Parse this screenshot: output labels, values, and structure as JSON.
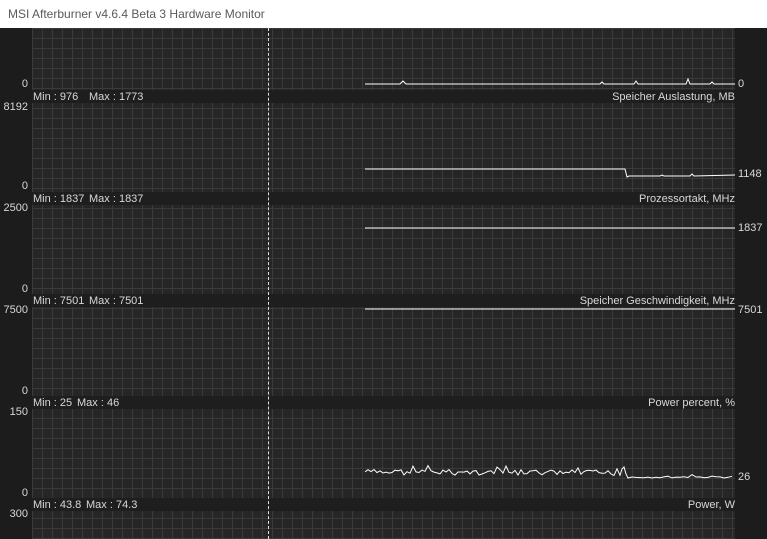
{
  "window": {
    "title": "MSI Afterburner v4.6.4 Beta 3 Hardware Monitor"
  },
  "graphs": [
    {
      "top_scale": "",
      "bottom_scale": "0",
      "current": "0",
      "min_label": "Min : 976",
      "max_label": "Max : 1773",
      "name": "Speicher Auslastung, MB"
    },
    {
      "top_scale": "8192",
      "bottom_scale": "0",
      "current": "1148",
      "min_label": "Min : 1837",
      "max_label": "Max : 1837",
      "name": "Prozessortakt, MHz"
    },
    {
      "top_scale": "2500",
      "bottom_scale": "0",
      "current": "1837",
      "min_label": "Min : 7501",
      "max_label": "Max : 7501",
      "name": "Speicher Geschwindigkeit, MHz"
    },
    {
      "top_scale": "7500",
      "bottom_scale": "0",
      "current": "7501",
      "min_label": "Min : 25",
      "max_label": "Max : 46",
      "name": "Power percent, %"
    },
    {
      "top_scale": "150",
      "bottom_scale": "0",
      "current": "26",
      "min_label": "Min : 43.8",
      "max_label": "Max : 74.3",
      "name": "Power, W"
    },
    {
      "top_scale": "300",
      "bottom_scale": "",
      "current": "",
      "min_label": "",
      "max_label": "",
      "name": ""
    }
  ],
  "colors": {
    "trace": "#ffffff",
    "grid": "#3a3a3a",
    "background": "#262626",
    "cursor": "#e0e0e0"
  }
}
